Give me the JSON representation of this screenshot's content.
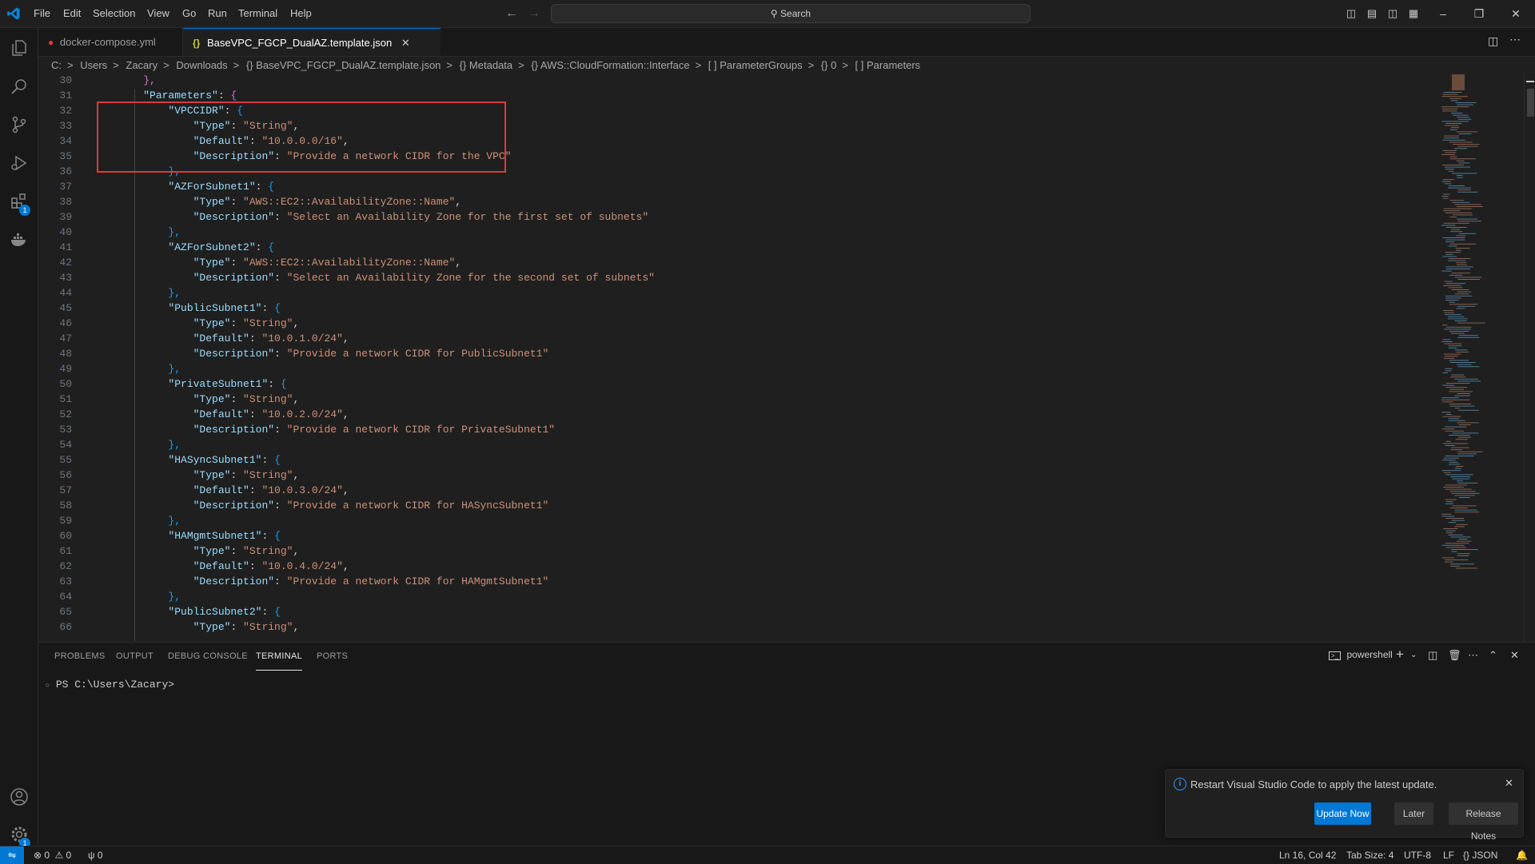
{
  "menu": [
    "File",
    "Edit",
    "Selection",
    "View",
    "Go",
    "Run",
    "Terminal",
    "Help"
  ],
  "search": {
    "label": "Search"
  },
  "tabs": [
    {
      "label": "docker-compose.yml"
    },
    {
      "label": "BaseVPC_FGCP_DualAZ.template.json"
    }
  ],
  "breadcrumb": [
    "C:",
    "Users",
    "Zacary",
    "Downloads",
    "{} BaseVPC_FGCP_DualAZ.template.json",
    "{} Metadata",
    "{} AWS::CloudFormation::Interface",
    "[ ] ParameterGroups",
    "{} 0",
    "[ ] Parameters"
  ],
  "activity_badges": {
    "extensions": "1",
    "manage": "1"
  },
  "editor": {
    "line_numbers": [
      "30",
      "31",
      "32",
      "33",
      "34",
      "35",
      "36",
      "37",
      "38",
      "39",
      "40",
      "41",
      "42",
      "43",
      "44",
      "45",
      "46",
      "47",
      "48",
      "49",
      "50",
      "51",
      "52",
      "53",
      "54",
      "55",
      "56",
      "57",
      "58",
      "59",
      "60",
      "61",
      "62",
      "63",
      "64",
      "65",
      "66"
    ],
    "lines": [
      [
        {
          "t": "    },",
          "c": "b1"
        }
      ],
      [
        {
          "t": "    ",
          "c": "p"
        },
        {
          "t": "\"Parameters\"",
          "c": "k"
        },
        {
          "t": ": ",
          "c": "p"
        },
        {
          "t": "{",
          "c": "b1"
        }
      ],
      [
        {
          "t": "        ",
          "c": "p"
        },
        {
          "t": "\"VPCCIDR\"",
          "c": "k"
        },
        {
          "t": ": ",
          "c": "p"
        },
        {
          "t": "{",
          "c": "b2"
        }
      ],
      [
        {
          "t": "            ",
          "c": "p"
        },
        {
          "t": "\"Type\"",
          "c": "k"
        },
        {
          "t": ": ",
          "c": "p"
        },
        {
          "t": "\"String\"",
          "c": "s"
        },
        {
          "t": ",",
          "c": "p"
        }
      ],
      [
        {
          "t": "            ",
          "c": "p"
        },
        {
          "t": "\"Default\"",
          "c": "k"
        },
        {
          "t": ": ",
          "c": "p"
        },
        {
          "t": "\"10.0.0.0/16\"",
          "c": "s"
        },
        {
          "t": ",",
          "c": "p"
        }
      ],
      [
        {
          "t": "            ",
          "c": "p"
        },
        {
          "t": "\"Description\"",
          "c": "k"
        },
        {
          "t": ": ",
          "c": "p"
        },
        {
          "t": "\"Provide a network CIDR for the VPC\"",
          "c": "s"
        }
      ],
      [
        {
          "t": "        },",
          "c": "b2"
        }
      ],
      [
        {
          "t": "        ",
          "c": "p"
        },
        {
          "t": "\"AZForSubnet1\"",
          "c": "k"
        },
        {
          "t": ": ",
          "c": "p"
        },
        {
          "t": "{",
          "c": "b2"
        }
      ],
      [
        {
          "t": "            ",
          "c": "p"
        },
        {
          "t": "\"Type\"",
          "c": "k"
        },
        {
          "t": ": ",
          "c": "p"
        },
        {
          "t": "\"AWS::EC2::AvailabilityZone::Name\"",
          "c": "s"
        },
        {
          "t": ",",
          "c": "p"
        }
      ],
      [
        {
          "t": "            ",
          "c": "p"
        },
        {
          "t": "\"Description\"",
          "c": "k"
        },
        {
          "t": ": ",
          "c": "p"
        },
        {
          "t": "\"Select an Availability Zone for the first set of subnets\"",
          "c": "s"
        }
      ],
      [
        {
          "t": "        },",
          "c": "b2"
        }
      ],
      [
        {
          "t": "        ",
          "c": "p"
        },
        {
          "t": "\"AZForSubnet2\"",
          "c": "k"
        },
        {
          "t": ": ",
          "c": "p"
        },
        {
          "t": "{",
          "c": "b2"
        }
      ],
      [
        {
          "t": "            ",
          "c": "p"
        },
        {
          "t": "\"Type\"",
          "c": "k"
        },
        {
          "t": ": ",
          "c": "p"
        },
        {
          "t": "\"AWS::EC2::AvailabilityZone::Name\"",
          "c": "s"
        },
        {
          "t": ",",
          "c": "p"
        }
      ],
      [
        {
          "t": "            ",
          "c": "p"
        },
        {
          "t": "\"Description\"",
          "c": "k"
        },
        {
          "t": ": ",
          "c": "p"
        },
        {
          "t": "\"Select an Availability Zone for the second set of subnets\"",
          "c": "s"
        }
      ],
      [
        {
          "t": "        },",
          "c": "b2"
        }
      ],
      [
        {
          "t": "        ",
          "c": "p"
        },
        {
          "t": "\"PublicSubnet1\"",
          "c": "k"
        },
        {
          "t": ": ",
          "c": "p"
        },
        {
          "t": "{",
          "c": "b2"
        }
      ],
      [
        {
          "t": "            ",
          "c": "p"
        },
        {
          "t": "\"Type\"",
          "c": "k"
        },
        {
          "t": ": ",
          "c": "p"
        },
        {
          "t": "\"String\"",
          "c": "s"
        },
        {
          "t": ",",
          "c": "p"
        }
      ],
      [
        {
          "t": "            ",
          "c": "p"
        },
        {
          "t": "\"Default\"",
          "c": "k"
        },
        {
          "t": ": ",
          "c": "p"
        },
        {
          "t": "\"10.0.1.0/24\"",
          "c": "s"
        },
        {
          "t": ",",
          "c": "p"
        }
      ],
      [
        {
          "t": "            ",
          "c": "p"
        },
        {
          "t": "\"Description\"",
          "c": "k"
        },
        {
          "t": ": ",
          "c": "p"
        },
        {
          "t": "\"Provide a network CIDR for PublicSubnet1\"",
          "c": "s"
        }
      ],
      [
        {
          "t": "        },",
          "c": "b2"
        }
      ],
      [
        {
          "t": "        ",
          "c": "p"
        },
        {
          "t": "\"PrivateSubnet1\"",
          "c": "k"
        },
        {
          "t": ": ",
          "c": "p"
        },
        {
          "t": "{",
          "c": "b2"
        }
      ],
      [
        {
          "t": "            ",
          "c": "p"
        },
        {
          "t": "\"Type\"",
          "c": "k"
        },
        {
          "t": ": ",
          "c": "p"
        },
        {
          "t": "\"String\"",
          "c": "s"
        },
        {
          "t": ",",
          "c": "p"
        }
      ],
      [
        {
          "t": "            ",
          "c": "p"
        },
        {
          "t": "\"Default\"",
          "c": "k"
        },
        {
          "t": ": ",
          "c": "p"
        },
        {
          "t": "\"10.0.2.0/24\"",
          "c": "s"
        },
        {
          "t": ",",
          "c": "p"
        }
      ],
      [
        {
          "t": "            ",
          "c": "p"
        },
        {
          "t": "\"Description\"",
          "c": "k"
        },
        {
          "t": ": ",
          "c": "p"
        },
        {
          "t": "\"Provide a network CIDR for PrivateSubnet1\"",
          "c": "s"
        }
      ],
      [
        {
          "t": "        },",
          "c": "b2"
        }
      ],
      [
        {
          "t": "        ",
          "c": "p"
        },
        {
          "t": "\"HASyncSubnet1\"",
          "c": "k"
        },
        {
          "t": ": ",
          "c": "p"
        },
        {
          "t": "{",
          "c": "b2"
        }
      ],
      [
        {
          "t": "            ",
          "c": "p"
        },
        {
          "t": "\"Type\"",
          "c": "k"
        },
        {
          "t": ": ",
          "c": "p"
        },
        {
          "t": "\"String\"",
          "c": "s"
        },
        {
          "t": ",",
          "c": "p"
        }
      ],
      [
        {
          "t": "            ",
          "c": "p"
        },
        {
          "t": "\"Default\"",
          "c": "k"
        },
        {
          "t": ": ",
          "c": "p"
        },
        {
          "t": "\"10.0.3.0/24\"",
          "c": "s"
        },
        {
          "t": ",",
          "c": "p"
        }
      ],
      [
        {
          "t": "            ",
          "c": "p"
        },
        {
          "t": "\"Description\"",
          "c": "k"
        },
        {
          "t": ": ",
          "c": "p"
        },
        {
          "t": "\"Provide a network CIDR for HASyncSubnet1\"",
          "c": "s"
        }
      ],
      [
        {
          "t": "        },",
          "c": "b2"
        }
      ],
      [
        {
          "t": "        ",
          "c": "p"
        },
        {
          "t": "\"HAMgmtSubnet1\"",
          "c": "k"
        },
        {
          "t": ": ",
          "c": "p"
        },
        {
          "t": "{",
          "c": "b2"
        }
      ],
      [
        {
          "t": "            ",
          "c": "p"
        },
        {
          "t": "\"Type\"",
          "c": "k"
        },
        {
          "t": ": ",
          "c": "p"
        },
        {
          "t": "\"String\"",
          "c": "s"
        },
        {
          "t": ",",
          "c": "p"
        }
      ],
      [
        {
          "t": "            ",
          "c": "p"
        },
        {
          "t": "\"Default\"",
          "c": "k"
        },
        {
          "t": ": ",
          "c": "p"
        },
        {
          "t": "\"10.0.4.0/24\"",
          "c": "s"
        },
        {
          "t": ",",
          "c": "p"
        }
      ],
      [
        {
          "t": "            ",
          "c": "p"
        },
        {
          "t": "\"Description\"",
          "c": "k"
        },
        {
          "t": ": ",
          "c": "p"
        },
        {
          "t": "\"Provide a network CIDR for HAMgmtSubnet1\"",
          "c": "s"
        }
      ],
      [
        {
          "t": "        },",
          "c": "b2"
        }
      ],
      [
        {
          "t": "        ",
          "c": "p"
        },
        {
          "t": "\"PublicSubnet2\"",
          "c": "k"
        },
        {
          "t": ": ",
          "c": "p"
        },
        {
          "t": "{",
          "c": "b2"
        }
      ],
      [
        {
          "t": "            ",
          "c": "p"
        },
        {
          "t": "\"Type\"",
          "c": "k"
        },
        {
          "t": ": ",
          "c": "p"
        },
        {
          "t": "\"String\"",
          "c": "s"
        },
        {
          "t": ",",
          "c": "p"
        }
      ]
    ]
  },
  "panel": {
    "tabs": [
      "PROBLEMS",
      "OUTPUT",
      "DEBUG CONSOLE",
      "TERMINAL",
      "PORTS"
    ],
    "active_tab": "TERMINAL",
    "terminal_name": "powershell",
    "prompt": "PS C:\\Users\\Zacary>"
  },
  "notification": {
    "message": "Restart Visual Studio Code to apply the latest update.",
    "buttons": {
      "update": "Update Now",
      "later": "Later",
      "notes": "Release Notes"
    }
  },
  "statusbar": {
    "errors": "0",
    "warnings": "0",
    "ports": "0",
    "position": "Ln 16, Col 42",
    "tab_size": "Tab Size: 4",
    "encoding": "UTF-8",
    "eol": "LF",
    "language": "JSON"
  },
  "colors": {
    "accent": "#0078d4",
    "highlight_box": "#e0383e",
    "key": "#9cdcfe",
    "string": "#ce9178"
  }
}
